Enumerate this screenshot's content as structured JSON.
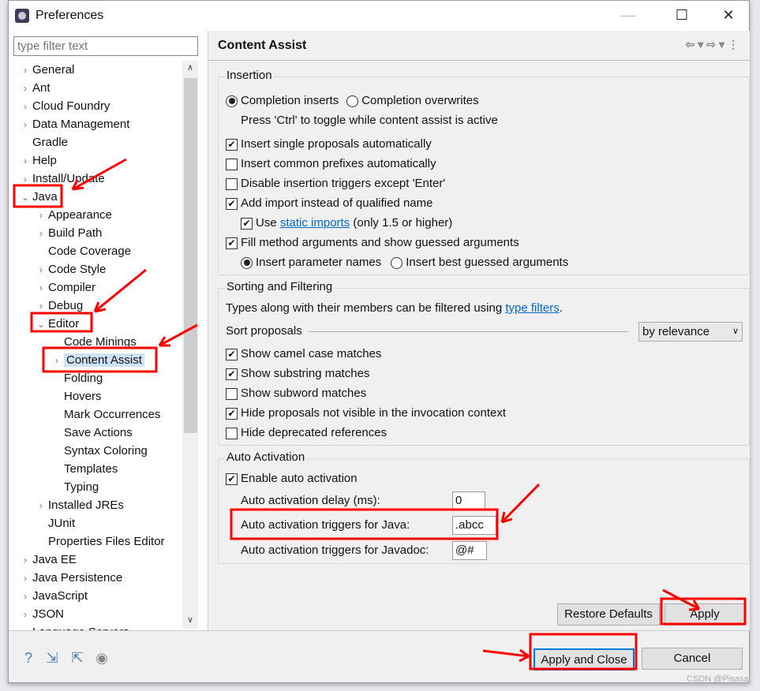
{
  "window": {
    "title": "Preferences",
    "minimize": "—",
    "maximize": "☐",
    "close": "✕"
  },
  "filter": {
    "placeholder": "type filter text"
  },
  "tree": [
    {
      "label": "General",
      "level": 0,
      "exp": ">"
    },
    {
      "label": "Ant",
      "level": 0,
      "exp": ">"
    },
    {
      "label": "Cloud Foundry",
      "level": 0,
      "exp": ">"
    },
    {
      "label": "Data Management",
      "level": 0,
      "exp": ">"
    },
    {
      "label": "Gradle",
      "level": 0,
      "exp": ""
    },
    {
      "label": "Help",
      "level": 0,
      "exp": ">"
    },
    {
      "label": "Install/Update",
      "level": 0,
      "exp": ">"
    },
    {
      "label": "Java",
      "level": 0,
      "exp": "v"
    },
    {
      "label": "Appearance",
      "level": 1,
      "exp": ">"
    },
    {
      "label": "Build Path",
      "level": 1,
      "exp": ">"
    },
    {
      "label": "Code Coverage",
      "level": 1,
      "exp": ""
    },
    {
      "label": "Code Style",
      "level": 1,
      "exp": ">"
    },
    {
      "label": "Compiler",
      "level": 1,
      "exp": ">"
    },
    {
      "label": "Debug",
      "level": 1,
      "exp": ">"
    },
    {
      "label": "Editor",
      "level": 1,
      "exp": "v"
    },
    {
      "label": "Code Minings",
      "level": 2,
      "exp": ""
    },
    {
      "label": "Content Assist",
      "level": 2,
      "exp": ">",
      "selected": true
    },
    {
      "label": "Folding",
      "level": 2,
      "exp": ""
    },
    {
      "label": "Hovers",
      "level": 2,
      "exp": ""
    },
    {
      "label": "Mark Occurrences",
      "level": 2,
      "exp": ""
    },
    {
      "label": "Save Actions",
      "level": 2,
      "exp": ""
    },
    {
      "label": "Syntax Coloring",
      "level": 2,
      "exp": ""
    },
    {
      "label": "Templates",
      "level": 2,
      "exp": ""
    },
    {
      "label": "Typing",
      "level": 2,
      "exp": ""
    },
    {
      "label": "Installed JREs",
      "level": 1,
      "exp": ">"
    },
    {
      "label": "JUnit",
      "level": 1,
      "exp": ""
    },
    {
      "label": "Properties Files Editor",
      "level": 1,
      "exp": ""
    },
    {
      "label": "Java EE",
      "level": 0,
      "exp": ">"
    },
    {
      "label": "Java Persistence",
      "level": 0,
      "exp": ">"
    },
    {
      "label": "JavaScript",
      "level": 0,
      "exp": ">"
    },
    {
      "label": "JSON",
      "level": 0,
      "exp": ">"
    },
    {
      "label": "Language Servers",
      "level": 0,
      "exp": ">"
    }
  ],
  "page": {
    "title": "Content Assist",
    "nav_icons": "⇦▾⇨▾⋮"
  },
  "insertion": {
    "label": "Insertion",
    "radio1": "Completion inserts",
    "radio2": "Completion overwrites",
    "hint": "Press 'Ctrl' to toggle while content assist is active",
    "checks": [
      {
        "label": "Insert single proposals automatically",
        "checked": true
      },
      {
        "label": "Insert common prefixes automatically",
        "checked": false
      },
      {
        "label": "Disable insertion triggers except 'Enter'",
        "checked": false
      },
      {
        "label": "Add import instead of qualified name",
        "checked": true
      }
    ],
    "use": "Use",
    "static_imports": "static imports",
    "only": "(only 1.5 or higher)",
    "fill": "Fill method arguments and show guessed arguments",
    "param_names": "Insert parameter names",
    "best_guessed": "Insert best guessed arguments"
  },
  "sorting": {
    "label": "Sorting and Filtering",
    "desc": "Types along with their members can be filtered using",
    "link": "type filters",
    "period": ".",
    "sort_label": "Sort proposals",
    "sort_value": "by relevance",
    "checks": [
      {
        "label": "Show camel case matches",
        "checked": true
      },
      {
        "label": "Show substring matches",
        "checked": true
      },
      {
        "label": "Show subword matches",
        "checked": false
      },
      {
        "label": "Hide proposals not visible in the invocation context",
        "checked": true
      },
      {
        "label": "Hide deprecated references",
        "checked": false
      }
    ]
  },
  "auto": {
    "label": "Auto Activation",
    "enable": "Enable auto activation",
    "enabled": true,
    "delay_label": "Auto activation delay (ms):",
    "delay": "0",
    "java_label": "Auto activation triggers for Java:",
    "java": ".abcc",
    "javadoc_label": "Auto activation triggers for Javadoc:",
    "javadoc": "@#"
  },
  "buttons": {
    "restore": "Restore Defaults",
    "apply": "Apply",
    "apply_close": "Apply and Close",
    "cancel": "Cancel"
  },
  "bottom_icons": [
    "help-icon",
    "import-icon",
    "export-icon",
    "record-icon"
  ],
  "watermark": "CSDN @Pisasa",
  "colors": {
    "annotation": "#ff0000",
    "selection": "#cde4f7",
    "link": "#0066cc"
  }
}
